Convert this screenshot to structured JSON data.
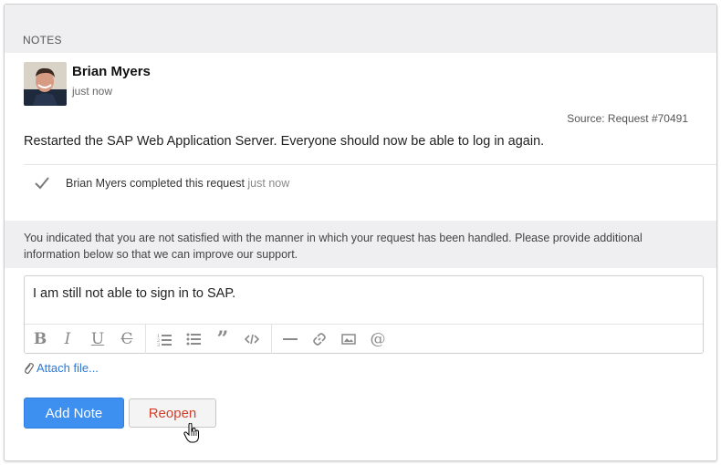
{
  "notes": {
    "header": "NOTES",
    "note": {
      "author": "Brian Myers",
      "time": "just now",
      "source": "Source: Request #70491",
      "text": "Restarted the SAP Web Application Server. Everyone should now be able to log in again."
    },
    "activity": {
      "text": "Brian Myers completed this request",
      "time": "just now",
      "icon": "check-icon"
    }
  },
  "feedback": {
    "message": "You indicated that you are not satisfied with the manner in which your request has been handled. Please provide additional information below so that we can improve our support."
  },
  "editor": {
    "value": "I am still not able to sign in to SAP.",
    "toolbar": [
      "bold-icon",
      "italic-icon",
      "underline-icon",
      "strikethrough-icon",
      "numbered-list-icon",
      "bullet-list-icon",
      "quote-icon",
      "code-icon",
      "horizontal-rule-icon",
      "link-icon",
      "image-icon",
      "mention-icon"
    ]
  },
  "attach": {
    "label": "Attach file..."
  },
  "buttons": {
    "add_note": "Add Note",
    "reopen": "Reopen"
  },
  "colors": {
    "primary": "#3d8ff0",
    "danger_text": "#d0402b",
    "link": "#2a7ad6",
    "header_bg": "#efeff1"
  }
}
